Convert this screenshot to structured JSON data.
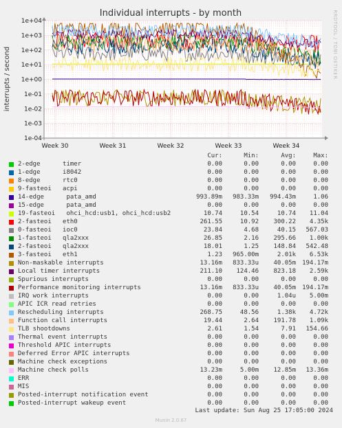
{
  "chart_data": {
    "type": "line",
    "title": "Individual interrupts - by month",
    "ylabel": "interrupts / second",
    "yscale": "log",
    "ylim": [
      0.0001,
      10000
    ],
    "y_ticks": [
      "1e+04",
      "1e+03",
      "1e+02",
      "1e+01",
      "1e+00",
      "1e-01",
      "1e-02",
      "1e-03",
      "1e-04"
    ],
    "x_ticks": [
      "Week 30",
      "Week 31",
      "Week 32",
      "Week 33",
      "Week 34"
    ],
    "grid": true,
    "columns": [
      "Cur:",
      "Min:",
      "Avg:",
      "Max:"
    ],
    "series": [
      {
        "name": "2-edge      timer",
        "color": "#00cc00",
        "cur": "0.00",
        "min": "0.00",
        "avg": "0.00",
        "max": "0.00"
      },
      {
        "name": "1-edge      i8042",
        "color": "#0066b3",
        "cur": "0.00",
        "min": "0.00",
        "avg": "0.00",
        "max": "0.00"
      },
      {
        "name": "8-edge      rtc0",
        "color": "#ff8000",
        "cur": "0.00",
        "min": "0.00",
        "avg": "0.00",
        "max": "0.00"
      },
      {
        "name": "9-fasteoi   acpi",
        "color": "#ffcc00",
        "cur": "0.00",
        "min": "0.00",
        "avg": "0.00",
        "max": "0.00"
      },
      {
        "name": "14-edge      pata_amd",
        "color": "#330099",
        "cur": "993.89m",
        "min": "983.33m",
        "avg": "994.43m",
        "max": "1.06"
      },
      {
        "name": "15-edge      pata_amd",
        "color": "#990099",
        "cur": "0.00",
        "min": "0.00",
        "avg": "0.00",
        "max": "0.00"
      },
      {
        "name": "19-fasteoi   ohci_hcd:usb1, ohci_hcd:usb2",
        "color": "#ccff00",
        "cur": "10.74",
        "min": "10.54",
        "avg": "10.74",
        "max": "11.04"
      },
      {
        "name": "2-fasteoi   eth0",
        "color": "#ff0000",
        "cur": "261.55",
        "min": "10.92",
        "avg": "300.22",
        "max": "4.35k"
      },
      {
        "name": "0-fasteoi   ioc0",
        "color": "#808080",
        "cur": "23.84",
        "min": "4.68",
        "avg": "40.15",
        "max": "567.03"
      },
      {
        "name": "1-fasteoi   qla2xxx",
        "color": "#008f00",
        "cur": "26.85",
        "min": "2.16",
        "avg": "295.66",
        "max": "1.00k"
      },
      {
        "name": "2-fasteoi   qla2xxx",
        "color": "#00487d",
        "cur": "18.01",
        "min": "1.25",
        "avg": "148.84",
        "max": "542.48"
      },
      {
        "name": "3-fasteoi   eth1",
        "color": "#b35a00",
        "cur": "1.23",
        "min": "965.00m",
        "avg": "2.01k",
        "max": "6.53k"
      },
      {
        "name": "Non-maskable interrupts",
        "color": "#b38f00",
        "cur": "13.16m",
        "min": "833.33u",
        "avg": "40.05m",
        "max": "194.17m"
      },
      {
        "name": "Local timer interrupts",
        "color": "#6b006b",
        "cur": "211.10",
        "min": "124.46",
        "avg": "823.18",
        "max": "2.59k"
      },
      {
        "name": "Spurious interrupts",
        "color": "#8fb300",
        "cur": "0.00",
        "min": "0.00",
        "avg": "0.00",
        "max": "0.00"
      },
      {
        "name": "Performance monitoring interrupts",
        "color": "#b30000",
        "cur": "13.16m",
        "min": "833.33u",
        "avg": "40.05m",
        "max": "194.17m"
      },
      {
        "name": "IRQ work interrupts",
        "color": "#bebebe",
        "cur": "0.00",
        "min": "0.00",
        "avg": "1.04u",
        "max": "5.00m"
      },
      {
        "name": "APIC ICR read retries",
        "color": "#80ff80",
        "cur": "0.00",
        "min": "0.00",
        "avg": "0.00",
        "max": "0.00"
      },
      {
        "name": "Rescheduling interrupts",
        "color": "#80c9ff",
        "cur": "268.75",
        "min": "48.56",
        "avg": "1.38k",
        "max": "4.72k"
      },
      {
        "name": "Function call interrupts",
        "color": "#ffc080",
        "cur": "19.44",
        "min": "2.64",
        "avg": "191.78",
        "max": "1.09k"
      },
      {
        "name": "TLB shootdowns",
        "color": "#ffe680",
        "cur": "2.61",
        "min": "1.54",
        "avg": "7.91",
        "max": "154.66"
      },
      {
        "name": "Thermal event interrupts",
        "color": "#aa80ff",
        "cur": "0.00",
        "min": "0.00",
        "avg": "0.00",
        "max": "0.00"
      },
      {
        "name": "Threshold APIC interrupts",
        "color": "#ee00cc",
        "cur": "0.00",
        "min": "0.00",
        "avg": "0.00",
        "max": "0.00"
      },
      {
        "name": "Deferred Error APIC interrupts",
        "color": "#ff8080",
        "cur": "0.00",
        "min": "0.00",
        "avg": "0.00",
        "max": "0.00"
      },
      {
        "name": "Machine check exceptions",
        "color": "#666600",
        "cur": "0.00",
        "min": "0.00",
        "avg": "0.00",
        "max": "0.00"
      },
      {
        "name": "Machine check polls",
        "color": "#ffbfff",
        "cur": "13.23m",
        "min": "5.00m",
        "avg": "12.85m",
        "max": "13.36m"
      },
      {
        "name": "ERR",
        "color": "#00ffcc",
        "cur": "0.00",
        "min": "0.00",
        "avg": "0.00",
        "max": "0.00"
      },
      {
        "name": "MIS",
        "color": "#cc6699",
        "cur": "0.00",
        "min": "0.00",
        "avg": "0.00",
        "max": "0.00"
      },
      {
        "name": "Posted-interrupt notification event",
        "color": "#999900",
        "cur": "0.00",
        "min": "0.00",
        "avg": "0.00",
        "max": "0.00"
      },
      {
        "name": "Posted-interrupt wakeup event",
        "color": "#00cc00",
        "cur": "0.00",
        "min": "0.00",
        "avg": "0.00",
        "max": "0.00"
      }
    ]
  },
  "footer": "Last update: Sun Aug 25 17:05:00 2024",
  "version": "Munin 2.0.67",
  "watermark": "RRDTOOL / TOBI OETIKER"
}
